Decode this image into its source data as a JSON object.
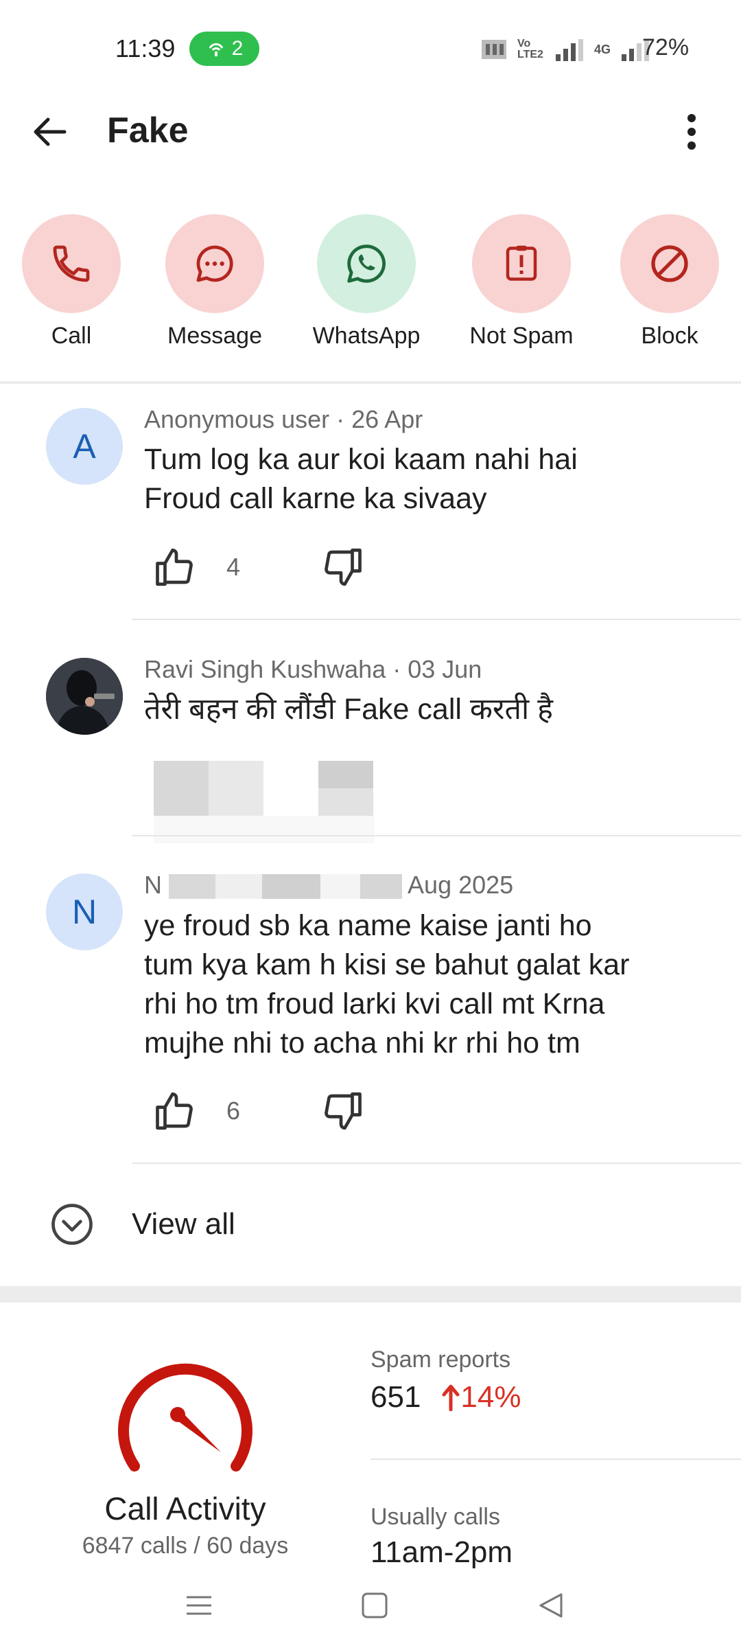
{
  "status_bar": {
    "time": "11:39",
    "hotspot_count": "2",
    "network_label": "Vo LTE2",
    "network_type": "4G",
    "battery": "72%"
  },
  "app_bar": {
    "title": "Fake"
  },
  "actions": [
    {
      "label": "Call",
      "icon": "phone-icon",
      "color": "#f8d3d2"
    },
    {
      "label": "Message",
      "icon": "message-icon",
      "color": "#f8d3d2"
    },
    {
      "label": "WhatsApp",
      "icon": "whatsapp-icon",
      "color": "#d3efdf"
    },
    {
      "label": "Not Spam",
      "icon": "not-spam-icon",
      "color": "#f8d3d2"
    },
    {
      "label": "Block",
      "icon": "block-icon",
      "color": "#f8d3d2"
    }
  ],
  "comments": [
    {
      "avatar_letter": "A",
      "meta": "Anonymous user · 26 Apr",
      "lines": [
        "Tum log ka aur koi kaam nahi hai",
        "Froud call karne ka sivaay"
      ],
      "likes": "4"
    },
    {
      "meta": "Ravi Singh Kushwaha · 03 Jun",
      "lines": [
        "तेरी बहन की लौंडी Fake call करती है"
      ]
    },
    {
      "avatar_letter": "N",
      "meta_prefix": "N",
      "meta_suffix": "Aug 2025",
      "lines": [
        "ye froud sb ka name kaise janti ho",
        "tum kya kam h kisi se bahut galat kar",
        "rhi ho tm froud larki kvi call mt Krna",
        "mujhe nhi to acha nhi kr rhi ho tm"
      ],
      "likes": "6"
    }
  ],
  "view_all": "View all",
  "activity": {
    "title": "Call Activity",
    "subtitle": "6847 calls / 60 days",
    "spam_reports_label": "Spam reports",
    "spam_reports_value": "651",
    "spam_reports_trend": "14%",
    "usually_calls_label": "Usually calls",
    "usually_calls_value": "11am-2pm",
    "accent": "#c5160e"
  }
}
